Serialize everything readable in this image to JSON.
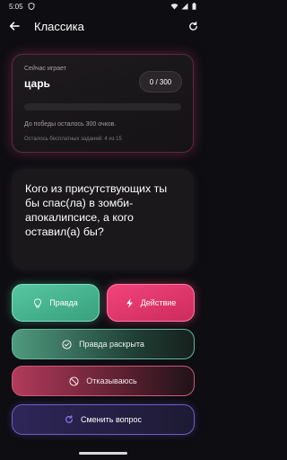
{
  "status_bar": {
    "time": "5:05",
    "icons": [
      "shield-icon",
      "wifi-icon",
      "signal-icon",
      "battery-icon"
    ]
  },
  "header": {
    "title": "Классика",
    "back_icon": "arrow-left-icon",
    "refresh_icon": "refresh-icon"
  },
  "status_card": {
    "now_playing_label": "Сейчас играет",
    "player_name": "царь",
    "score": "0 / 300",
    "progress_fraction": 0.0,
    "goal_text": "До победы осталось 300 очков.",
    "free_tasks_text": "Осталось бесплатных заданий: 4 из 15"
  },
  "question": {
    "text": "Кого из присутствующих ты бы спас(ла) в зомби-апокалипсисе, а кого оставил(а) бы?"
  },
  "actions": {
    "truth_label": "Правда",
    "dare_label": "Действие",
    "revealed_label": "Правда раскрыта",
    "refuse_label": "Отказываюсь",
    "change_label": "Сменить вопрос"
  },
  "colors": {
    "accent_pink": "#d84d7c",
    "truth_green": "#4cb893",
    "dare_pink": "#e83a6f",
    "change_purple": "#6c5dc8",
    "background": "#0e0d12"
  }
}
